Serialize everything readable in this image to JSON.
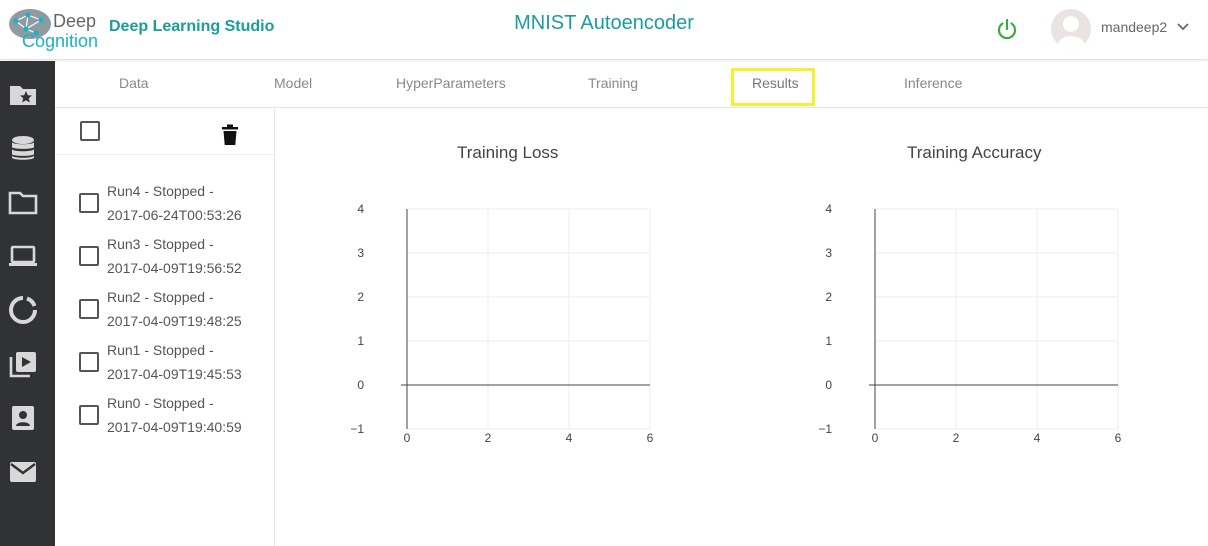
{
  "header": {
    "logo_line1": "Deep",
    "logo_line2": "Cognition",
    "app_name": "Deep Learning Studio",
    "project_title": "MNIST Autoencoder",
    "username": "mandeep2"
  },
  "sidebar": {
    "items": [
      {
        "icon": "starred-folder-icon"
      },
      {
        "icon": "database-icon"
      },
      {
        "icon": "folder-icon"
      },
      {
        "icon": "laptop-icon"
      },
      {
        "icon": "refresh-circle-icon"
      },
      {
        "icon": "video-library-icon"
      },
      {
        "icon": "contact-card-icon"
      },
      {
        "icon": "mail-icon"
      }
    ],
    "background": "#303236"
  },
  "tabs": [
    {
      "label": "Data"
    },
    {
      "label": "Model"
    },
    {
      "label": "HyperParameters"
    },
    {
      "label": "Training"
    },
    {
      "label": "Results",
      "active": true
    },
    {
      "label": "Inference"
    }
  ],
  "runs": [
    {
      "name": "Run4 - Stopped -",
      "time": "2017-06-24T00:53:26"
    },
    {
      "name": "Run3 - Stopped -",
      "time": "2017-04-09T19:56:52"
    },
    {
      "name": "Run2 - Stopped -",
      "time": "2017-04-09T19:48:25"
    },
    {
      "name": "Run1 - Stopped -",
      "time": "2017-04-09T19:45:53"
    },
    {
      "name": "Run0 - Stopped -",
      "time": "2017-04-09T19:40:59"
    }
  ],
  "chart_data": [
    {
      "type": "line",
      "title": "Training Loss",
      "series": [],
      "xlim": [
        0,
        6
      ],
      "ylim": [
        -1,
        4
      ],
      "x_ticks": [
        "0",
        "2",
        "4",
        "6"
      ],
      "y_ticks": [
        "4",
        "3",
        "2",
        "1",
        "0",
        "−1"
      ],
      "grid": true
    },
    {
      "type": "line",
      "title": "Training Accuracy",
      "series": [],
      "xlim": [
        0,
        6
      ],
      "ylim": [
        -1,
        4
      ],
      "x_ticks": [
        "0",
        "2",
        "4",
        "6"
      ],
      "y_ticks": [
        "4",
        "3",
        "2",
        "1",
        "0",
        "−1"
      ],
      "grid": true
    }
  ],
  "colors": {
    "brand_teal": "#199e9b",
    "power_green": "#3daa3d",
    "active_tab_highlight": "#f2f230"
  }
}
